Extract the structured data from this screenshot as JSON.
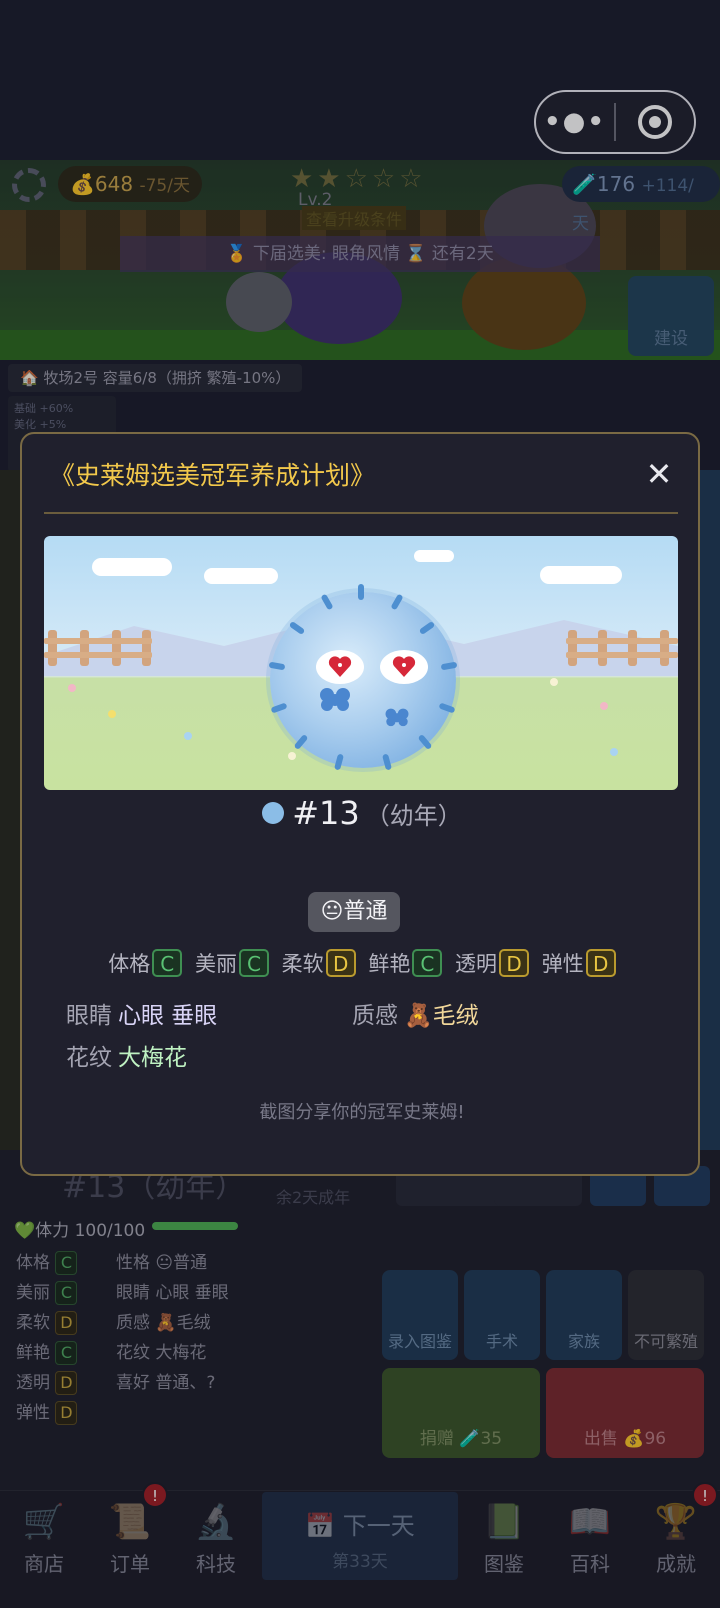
{
  "status": {
    "coins": "648",
    "coins_rate": "-75/天",
    "points": "176",
    "points_rate": "+114/天",
    "stars_text": "★★☆☆☆",
    "level": "Lv.2",
    "upgrade_link": "查看升级条件",
    "contest": "🏅 下届选美: 眼角风情  ⌛ 还有2天",
    "build_label": "建设"
  },
  "ranch": {
    "label": "牧场2号  容量6/8（拥挤 繁殖-10%）",
    "bonus_lines": [
      "基础  +60%",
      "美化  +5%"
    ]
  },
  "modal": {
    "title": "《史莱姆选美冠军养成计划》",
    "close": "✕",
    "slime_id": "#13",
    "slime_age": "（幼年）",
    "personality": "😐普通",
    "grades": [
      {
        "label": "体格",
        "grade": "C",
        "tone": "green"
      },
      {
        "label": "美丽",
        "grade": "C",
        "tone": "green"
      },
      {
        "label": "柔软",
        "grade": "D",
        "tone": "yellow"
      },
      {
        "label": "鲜艳",
        "grade": "C",
        "tone": "green"
      },
      {
        "label": "透明",
        "grade": "D",
        "tone": "yellow"
      },
      {
        "label": "弹性",
        "grade": "D",
        "tone": "yellow"
      }
    ],
    "eyes_label": "眼睛",
    "eyes_value": "心眼 垂眼",
    "texture_label": "质感",
    "texture_value": "🧸毛绒",
    "pattern_label": "花纹",
    "pattern_value": "大梅花",
    "share_hint": "截图分享你的冠军史莱姆!"
  },
  "detail": {
    "title": "#13（幼年）",
    "subtitle": "余2天成年",
    "hp": "💚体力 100/100",
    "left_stats": [
      {
        "label": "体格",
        "grade": "C"
      },
      {
        "label": "美丽",
        "grade": "C"
      },
      {
        "label": "柔软",
        "grade": "D"
      },
      {
        "label": "鲜艳",
        "grade": "C"
      },
      {
        "label": "透明",
        "grade": "D"
      },
      {
        "label": "弹性",
        "grade": "D"
      }
    ],
    "right_stats": [
      "性格 😐普通",
      "眼睛 心眼 垂眼",
      "质感 🧸毛绒",
      "花纹 大梅花",
      "喜好 普通、?"
    ],
    "actions": {
      "record": "录入图鉴",
      "surgery": "手术",
      "family": "家族",
      "no_breed": "不可繁殖",
      "donate": "捐赠 🧪35",
      "sell": "出售 💰96"
    }
  },
  "nav": {
    "shop": "商店",
    "orders": "订单",
    "tech": "科技",
    "next_day": "下一天",
    "day_count": "第33天",
    "codex": "图鉴",
    "wiki": "百科",
    "achievements": "成就",
    "badge": "!"
  },
  "colors": {
    "accent_gold": "#f2c84b",
    "grade_green": "#59c173",
    "grade_yellow": "#e8c542"
  }
}
